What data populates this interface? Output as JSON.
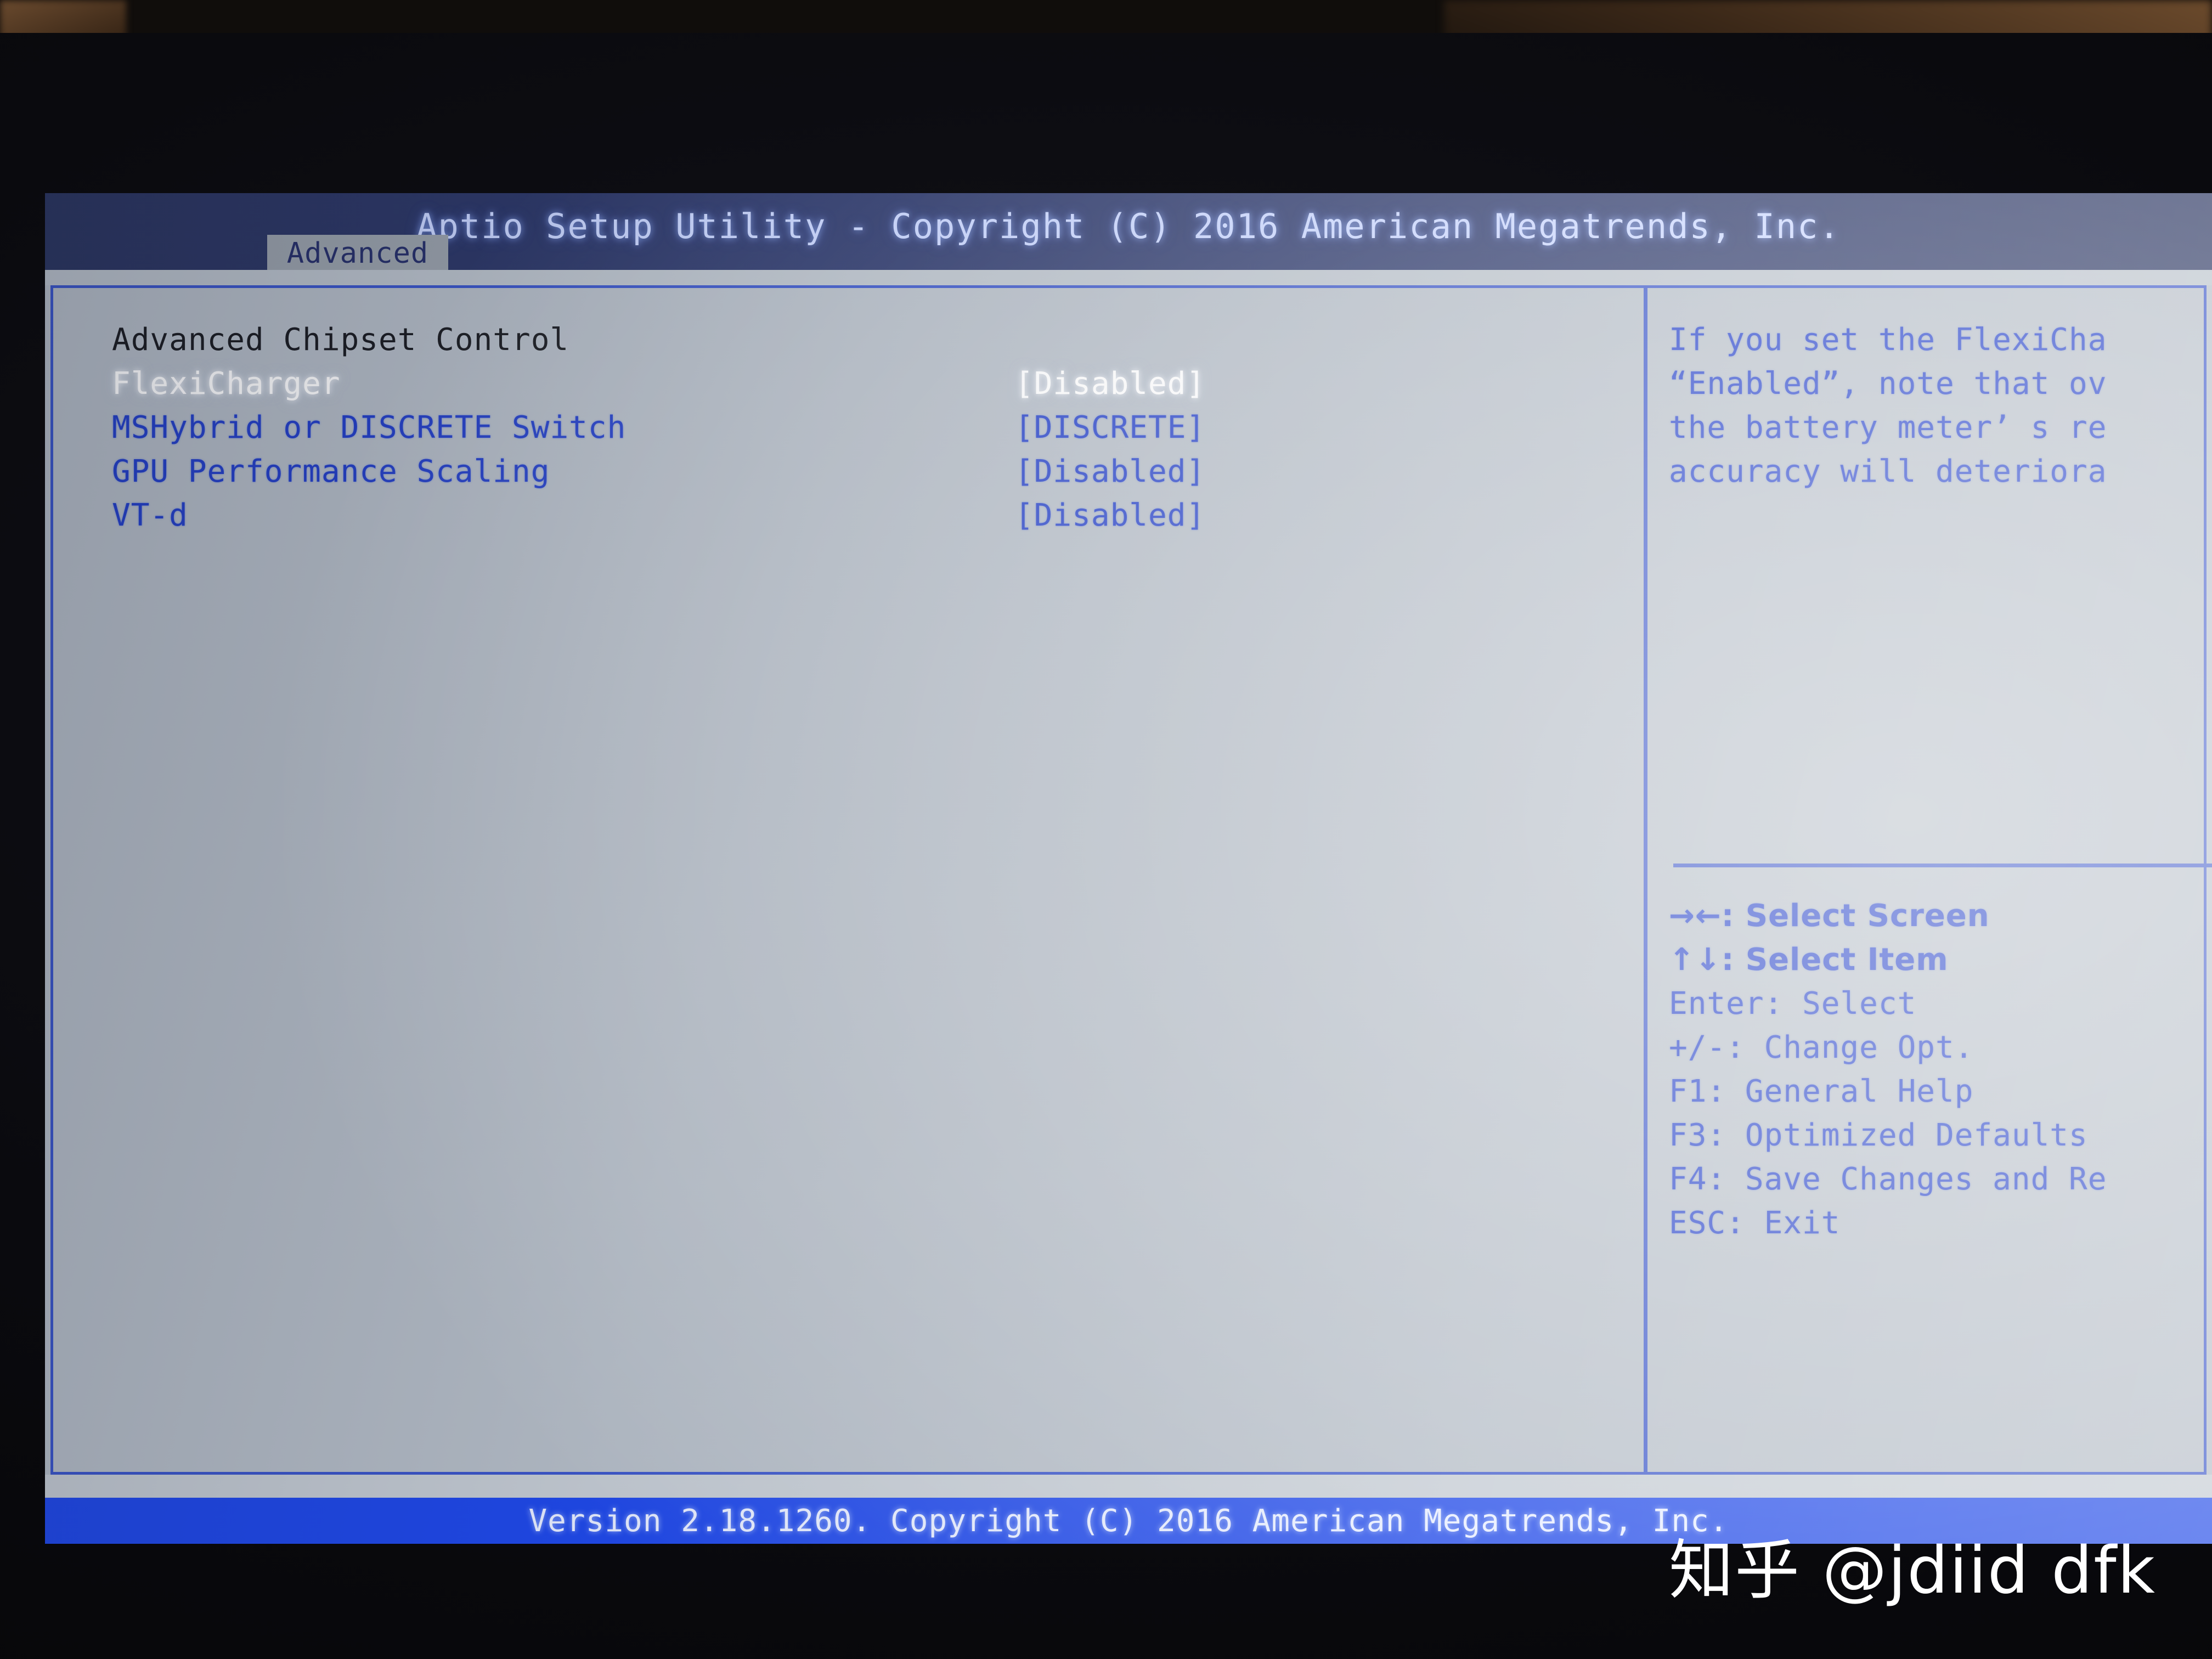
{
  "header": {
    "title": "Aptio Setup Utility - Copyright (C) 2016 American Megatrends, Inc.",
    "active_tab": "Advanced"
  },
  "main": {
    "section_title": "Advanced Chipset Control",
    "rows": [
      {
        "label": "FlexiCharger",
        "value": "[Disabled]",
        "selected": true
      },
      {
        "label": "MSHybrid or DISCRETE Switch",
        "value": "[DISCRETE]",
        "selected": false
      },
      {
        "label": "GPU Performance Scaling",
        "value": "[Disabled]",
        "selected": false
      },
      {
        "label": "VT-d",
        "value": "[Disabled]",
        "selected": false
      }
    ]
  },
  "help": {
    "lines": [
      "If you set the FlexiCha",
      "“Enabled”, note that ov",
      "the battery meter’ s re",
      "accuracy will deteriora"
    ]
  },
  "legend": {
    "lines": [
      "→←: Select Screen",
      "↑↓: Select Item",
      "Enter: Select",
      "+/-: Change Opt.",
      "F1: General Help",
      "F3: Optimized Defaults",
      "F4: Save Changes and Re",
      "ESC: Exit"
    ]
  },
  "footer": {
    "text": "Version 2.18.1260. Copyright (C) 2016 American Megatrends, Inc."
  },
  "watermark": {
    "text": "知乎 @jdiid dfk"
  },
  "colors": {
    "accent_blue": "#2440c8",
    "border_blue": "#3a55c8",
    "footer_blue": "#1f48e8",
    "header_navy": "#2e3a6d",
    "panel_gray": "#b4bcc6",
    "selected_white": "#ffffff"
  }
}
